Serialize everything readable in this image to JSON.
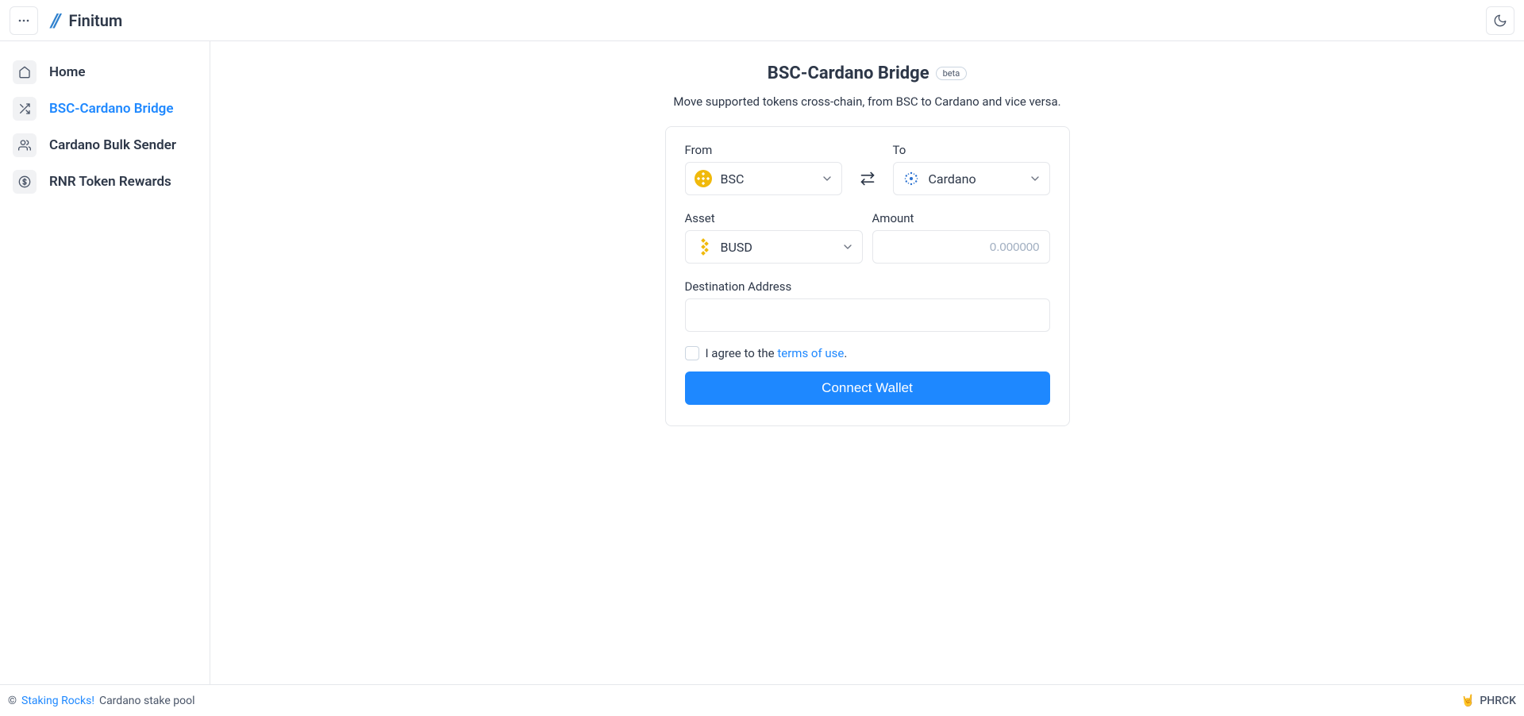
{
  "app": {
    "title": "Finitum"
  },
  "sidebar": {
    "items": [
      {
        "label": "Home"
      },
      {
        "label": "BSC-Cardano Bridge"
      },
      {
        "label": "Cardano Bulk Sender"
      },
      {
        "label": "RNR Token Rewards"
      }
    ]
  },
  "page": {
    "title": "BSC-Cardano Bridge",
    "badge": "beta",
    "subtitle": "Move supported tokens cross-chain, from BSC to Cardano and vice versa."
  },
  "bridge": {
    "from_label": "From",
    "to_label": "To",
    "from_value": "BSC",
    "to_value": "Cardano",
    "asset_label": "Asset",
    "asset_value": "BUSD",
    "amount_label": "Amount",
    "amount_placeholder": "0.000000",
    "destination_label": "Destination Address",
    "agree_prefix": "I agree to the ",
    "terms_link": "terms of use",
    "agree_suffix": ".",
    "connect_label": "Connect Wallet"
  },
  "footer": {
    "copyright_symbol": "©",
    "link_text": "Staking Rocks!",
    "suffix": " Cardano stake pool",
    "pool": "PHRCK",
    "pool_emoji": "🤘"
  }
}
